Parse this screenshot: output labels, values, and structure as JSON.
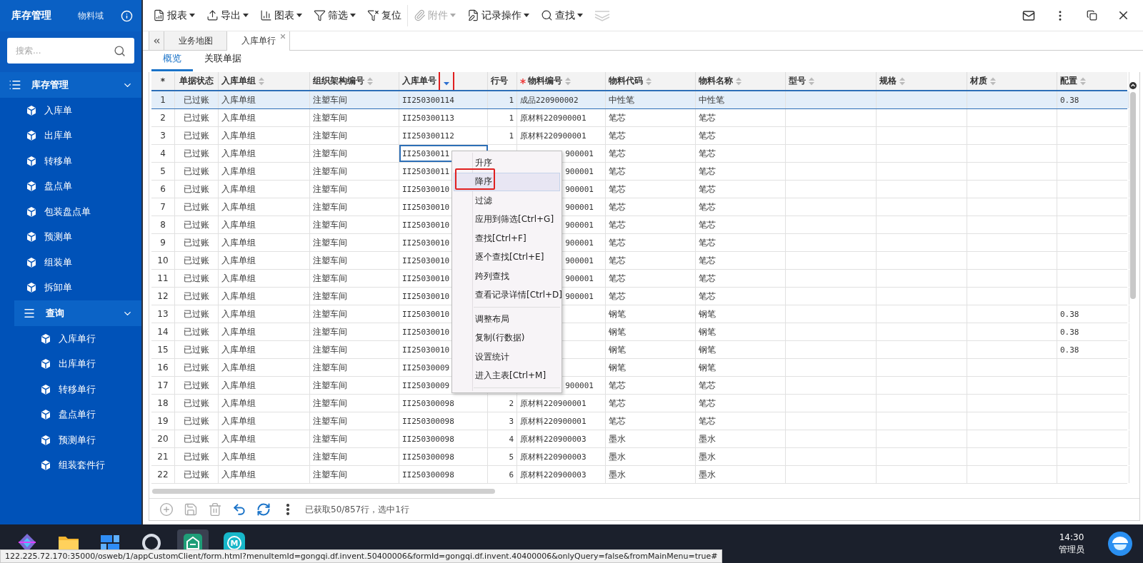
{
  "sidebar": {
    "title": "库存管理",
    "domain": "物料域",
    "search": {
      "placeholder": "搜索..."
    },
    "groups": [
      {
        "label": "库存管理",
        "expanded": true,
        "items": [
          {
            "label": "入库单",
            "kind": "item"
          },
          {
            "label": "出库单",
            "kind": "item"
          },
          {
            "label": "转移单",
            "kind": "item"
          },
          {
            "label": "盘点单",
            "kind": "item"
          },
          {
            "label": "包装盘点单",
            "kind": "item"
          },
          {
            "label": "预测单",
            "kind": "item"
          },
          {
            "label": "组装单",
            "kind": "item"
          },
          {
            "label": "拆卸单",
            "kind": "item"
          },
          {
            "label": "查询",
            "kind": "group",
            "expanded": true,
            "children": [
              {
                "label": "入库单行"
              },
              {
                "label": "出库单行"
              },
              {
                "label": "转移单行"
              },
              {
                "label": "盘点单行"
              },
              {
                "label": "预测单行"
              },
              {
                "label": "组装套件行"
              }
            ]
          }
        ]
      }
    ]
  },
  "toolbar": [
    {
      "label": "报表",
      "kind": "report",
      "dropdown": true,
      "disabled": false
    },
    {
      "label": "导出",
      "kind": "export",
      "dropdown": true,
      "disabled": false
    },
    {
      "label": "图表",
      "kind": "chart",
      "dropdown": true,
      "disabled": false
    },
    {
      "label": "筛选",
      "kind": "filter",
      "dropdown": true,
      "disabled": false
    },
    {
      "label": "复位",
      "kind": "reset",
      "dropdown": false,
      "disabled": false
    },
    {
      "label": "附件",
      "kind": "attach",
      "dropdown": true,
      "disabled": true
    },
    {
      "label": "记录操作",
      "kind": "record",
      "dropdown": true,
      "disabled": false
    },
    {
      "label": "查找",
      "kind": "search",
      "dropdown": true,
      "disabled": false
    }
  ],
  "tabs": [
    {
      "label": "业务地图",
      "selected": false,
      "closable": false
    },
    {
      "label": "入库单行",
      "selected": true,
      "closable": true
    }
  ],
  "subtabs": [
    {
      "label": "概览",
      "selected": true
    },
    {
      "label": "关联单据",
      "selected": false
    }
  ],
  "table": {
    "columns": [
      {
        "label": "*",
        "kind": "index",
        "sortable": false
      },
      {
        "label": "单据状态",
        "sortable": false
      },
      {
        "label": "入库单组",
        "sortable": true,
        "sorted_desc": false
      },
      {
        "label": "组织架构编号",
        "sortable": true,
        "sorted_desc": false
      },
      {
        "label": "入库单号",
        "sortable": true,
        "sorted_desc": true,
        "annotated": true,
        "focus_column": true
      },
      {
        "label": "行号",
        "sortable": false
      },
      {
        "label": "物料编号",
        "sortable": true,
        "sorted_desc": false,
        "required": true
      },
      {
        "label": "物料代码",
        "sortable": true,
        "sorted_desc": false
      },
      {
        "label": "物料名称",
        "sortable": true,
        "sorted_desc": false
      },
      {
        "label": "型号",
        "sortable": true,
        "sorted_desc": false
      },
      {
        "label": "规格",
        "sortable": true,
        "sorted_desc": false
      },
      {
        "label": "材质",
        "sortable": true,
        "sorted_desc": false
      },
      {
        "label": "配置",
        "sortable": true,
        "sorted_desc": false
      }
    ],
    "rows": [
      {
        "selected": true,
        "cells": [
          "1",
          "已过账",
          "入库单组",
          "注塑车间",
          "II250300114",
          "1",
          "成品220900002",
          "中性笔",
          "中性笔",
          "",
          "",
          "",
          "0.38"
        ]
      },
      {
        "selected": false,
        "cells": [
          "2",
          "已过账",
          "入库单组",
          "注塑车间",
          "II250300113",
          "1",
          "原材料220900001",
          "笔芯",
          "笔芯",
          "",
          "",
          "",
          ""
        ]
      },
      {
        "selected": false,
        "cells": [
          "3",
          "已过账",
          "入库单组",
          "注塑车间",
          "II250300112",
          "1",
          "原材料220900001",
          "笔芯",
          "笔芯",
          "",
          "",
          "",
          ""
        ]
      },
      {
        "selected": false,
        "focus": true,
        "under_menu": true,
        "cells": [
          "4",
          "已过账",
          "入库单组",
          "注塑车间",
          "II25030011",
          "",
          "900001",
          "笔芯",
          "笔芯",
          "",
          "",
          "",
          ""
        ]
      },
      {
        "selected": false,
        "under_menu": true,
        "cells": [
          "5",
          "已过账",
          "入库单组",
          "注塑车间",
          "II25030011",
          "",
          "900001",
          "笔芯",
          "笔芯",
          "",
          "",
          "",
          ""
        ]
      },
      {
        "selected": false,
        "under_menu": true,
        "cells": [
          "6",
          "已过账",
          "入库单组",
          "注塑车间",
          "II25030010",
          "",
          "900001",
          "笔芯",
          "笔芯",
          "",
          "",
          "",
          ""
        ]
      },
      {
        "selected": false,
        "under_menu": true,
        "cells": [
          "7",
          "已过账",
          "入库单组",
          "注塑车间",
          "II25030010",
          "",
          "900001",
          "笔芯",
          "笔芯",
          "",
          "",
          "",
          ""
        ]
      },
      {
        "selected": false,
        "under_menu": true,
        "cells": [
          "8",
          "已过账",
          "入库单组",
          "注塑车间",
          "II25030010",
          "",
          "900001",
          "笔芯",
          "笔芯",
          "",
          "",
          "",
          ""
        ]
      },
      {
        "selected": false,
        "under_menu": true,
        "cells": [
          "9",
          "已过账",
          "入库单组",
          "注塑车间",
          "II25030010",
          "",
          "900001",
          "笔芯",
          "笔芯",
          "",
          "",
          "",
          ""
        ]
      },
      {
        "selected": false,
        "under_menu": true,
        "cells": [
          "10",
          "已过账",
          "入库单组",
          "注塑车间",
          "II25030010",
          "",
          "900001",
          "笔芯",
          "笔芯",
          "",
          "",
          "",
          ""
        ]
      },
      {
        "selected": false,
        "under_menu": true,
        "cells": [
          "11",
          "已过账",
          "入库单组",
          "注塑车间",
          "II25030010",
          "",
          "900001",
          "笔芯",
          "笔芯",
          "",
          "",
          "",
          ""
        ]
      },
      {
        "selected": false,
        "under_menu": true,
        "cells": [
          "12",
          "已过账",
          "入库单组",
          "注塑车间",
          "II25030010",
          "",
          "900001",
          "笔芯",
          "笔芯",
          "",
          "",
          "",
          ""
        ]
      },
      {
        "selected": false,
        "under_menu": true,
        "cells": [
          "13",
          "已过账",
          "入库单组",
          "注塑车间",
          "II25030010",
          "",
          "",
          "钢笔",
          "钢笔",
          "",
          "",
          "",
          "0.38"
        ]
      },
      {
        "selected": false,
        "under_menu": true,
        "cells": [
          "14",
          "已过账",
          "入库单组",
          "注塑车间",
          "II25030010",
          "",
          "",
          "钢笔",
          "钢笔",
          "",
          "",
          "",
          "0.38"
        ]
      },
      {
        "selected": false,
        "under_menu": true,
        "cells": [
          "15",
          "已过账",
          "入库单组",
          "注塑车间",
          "II25030010",
          "",
          "",
          "钢笔",
          "钢笔",
          "",
          "",
          "",
          "0.38"
        ]
      },
      {
        "selected": false,
        "under_menu": true,
        "cells": [
          "16",
          "已过账",
          "入库单组",
          "注塑车间",
          "II25030009",
          "",
          "",
          "钢笔",
          "钢笔",
          "",
          "",
          "",
          ""
        ]
      },
      {
        "selected": false,
        "under_menu": true,
        "cells": [
          "17",
          "已过账",
          "入库单组",
          "注塑车间",
          "II25030009",
          "",
          "900001",
          "笔芯",
          "笔芯",
          "",
          "",
          "",
          ""
        ]
      },
      {
        "selected": false,
        "cells": [
          "18",
          "已过账",
          "入库单组",
          "注塑车间",
          "II250300098",
          "2",
          "原材料220900001",
          "笔芯",
          "笔芯",
          "",
          "",
          "",
          ""
        ]
      },
      {
        "selected": false,
        "cells": [
          "19",
          "已过账",
          "入库单组",
          "注塑车间",
          "II250300098",
          "3",
          "原材料220900001",
          "笔芯",
          "笔芯",
          "",
          "",
          "",
          ""
        ]
      },
      {
        "selected": false,
        "cells": [
          "20",
          "已过账",
          "入库单组",
          "注塑车间",
          "II250300098",
          "4",
          "原材料220900003",
          "墨水",
          "墨水",
          "",
          "",
          "",
          ""
        ]
      },
      {
        "selected": false,
        "cells": [
          "21",
          "已过账",
          "入库单组",
          "注塑车间",
          "II250300098",
          "5",
          "原材料220900003",
          "墨水",
          "墨水",
          "",
          "",
          "",
          ""
        ]
      },
      {
        "selected": false,
        "cells": [
          "22",
          "已过账",
          "入库单组",
          "注塑车间",
          "II250300098",
          "6",
          "原材料220900003",
          "墨水",
          "墨水",
          "",
          "",
          "",
          ""
        ]
      }
    ]
  },
  "context_menu": [
    {
      "kind": "item",
      "label": "升序",
      "hover": false
    },
    {
      "kind": "item",
      "label": "降序",
      "hover": true,
      "annotated": true
    },
    {
      "kind": "item",
      "label": "过滤",
      "hover": false
    },
    {
      "kind": "item",
      "label": "应用到筛选[Ctrl+G]",
      "hover": false
    },
    {
      "kind": "item",
      "label": "查找[Ctrl+F]",
      "hover": false
    },
    {
      "kind": "item",
      "label": "逐个查找[Ctrl+E]",
      "hover": false
    },
    {
      "kind": "item",
      "label": "跨列查找",
      "hover": false
    },
    {
      "kind": "item",
      "label": "查看记录详情[Ctrl+D]",
      "hover": false
    },
    {
      "kind": "separator"
    },
    {
      "kind": "item",
      "label": "调整布局",
      "hover": false
    },
    {
      "kind": "item",
      "label": "复制(行数据)",
      "hover": false
    },
    {
      "kind": "item",
      "label": "设置统计",
      "hover": false
    },
    {
      "kind": "item",
      "label": "进入主表[Ctrl+M]",
      "hover": false
    },
    {
      "kind": "separator"
    }
  ],
  "footer": {
    "actions": [
      {
        "kind": "add",
        "disabled": true
      },
      {
        "kind": "save",
        "disabled": true
      },
      {
        "kind": "delete",
        "disabled": true
      },
      {
        "kind": "undo",
        "disabled": false
      },
      {
        "kind": "refresh",
        "disabled": false
      },
      {
        "kind": "more",
        "disabled": false
      }
    ],
    "status": "已获取50/857行，选中1行"
  },
  "taskbar": {
    "apps": [
      {
        "kind": "start",
        "active": false
      },
      {
        "kind": "folder",
        "active": false
      },
      {
        "kind": "grid",
        "active": false
      },
      {
        "kind": "circle",
        "active": false
      },
      {
        "kind": "store",
        "active": true
      },
      {
        "kind": "badge",
        "active": false,
        "letter": "M"
      }
    ],
    "time": "14:30",
    "user": "管理员"
  },
  "status_url": "122.225.72.170:35000/osweb/1/appCustomClient/form.html?menuItemId=gongqi.df.invent.50400006&formId=gongqi.df.invent.40400006&onlyQuery=false&fromMainMenu=true#"
}
